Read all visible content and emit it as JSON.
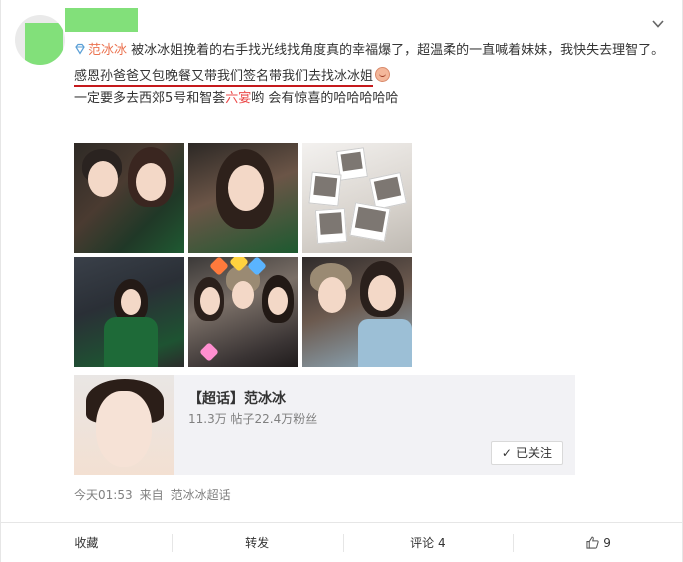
{
  "post": {
    "author_mention": "范冰冰",
    "text_main": "被冰冰姐挽着的右手找光线找角度真的幸福爆了，超温柔的一直喊着妹妹，我快失去理智了。",
    "text_underlined": "感恩孙爸爸又包晚餐又带我们签名带我们去找冰冰姐",
    "text_line3_a": "一定要多去西郊5号和智荟",
    "text_line3_red": "六宴",
    "text_line3_b": "哟 会有惊喜的哈哈哈哈哈",
    "emoji_icon": "grin-emoji-icon"
  },
  "super_topic": {
    "title": "【超话】范冰冰",
    "stats": "11.3万 帖子22.4万粉丝",
    "follow_label": "已关注"
  },
  "meta": {
    "time": "今天01:53",
    "source_prefix": "来自",
    "source_name": "范冰冰超话"
  },
  "actions": {
    "favorite": "收藏",
    "repost": "转发",
    "comment": "评论 4",
    "like_count": "9"
  },
  "colors": {
    "link": "#eb7350",
    "underline": "#c5191c",
    "mask": "#82e07a"
  }
}
